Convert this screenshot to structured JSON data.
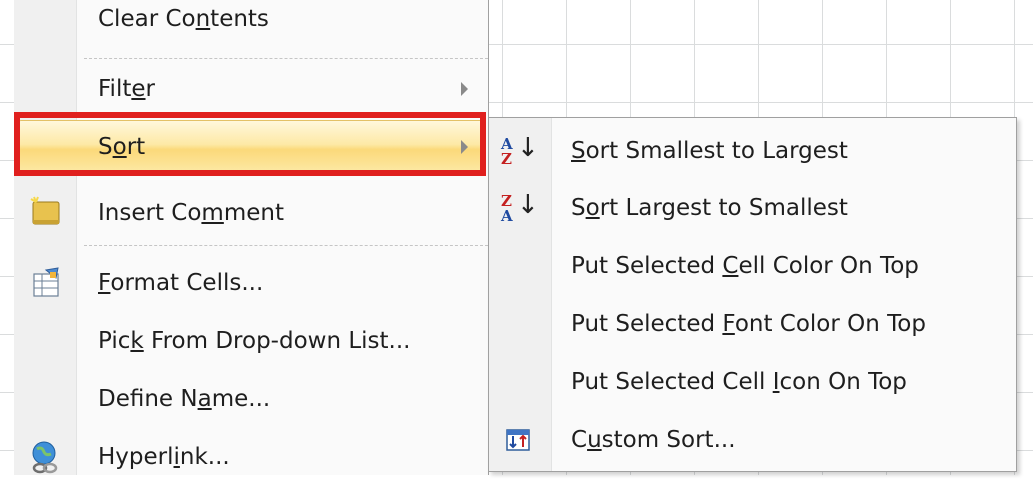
{
  "context_menu": {
    "items": [
      {
        "label_pre": "Clear Co",
        "label_u": "n",
        "label_post": "tents",
        "has_submenu": false
      },
      {
        "label_pre": "Filt",
        "label_u": "e",
        "label_post": "r",
        "has_submenu": true
      },
      {
        "label_pre": "S",
        "label_u": "o",
        "label_post": "rt",
        "has_submenu": true
      },
      {
        "label_pre": "Insert Co",
        "label_u": "m",
        "label_post": "ment",
        "has_submenu": false
      },
      {
        "label_pre": "",
        "label_u": "F",
        "label_post": "ormat Cells...",
        "has_submenu": false
      },
      {
        "label_pre": "Pic",
        "label_u": "k",
        "label_post": " From Drop-down List...",
        "has_submenu": false
      },
      {
        "label_pre": "Define N",
        "label_u": "a",
        "label_post": "me...",
        "has_submenu": false
      },
      {
        "label_pre": "Hyperl",
        "label_u": "i",
        "label_post": "nk...",
        "has_submenu": false
      }
    ],
    "highlighted_item": "Sort",
    "icons": [
      "insert-comment-icon",
      "format-cells-icon",
      "hyperlink-icon"
    ]
  },
  "sort_submenu": {
    "items": [
      {
        "label_pre": "",
        "label_u": "S",
        "label_post": "ort Smallest to Largest",
        "icon": "sort-ascending-icon"
      },
      {
        "label_pre": "S",
        "label_u": "o",
        "label_post": "rt Largest to Smallest",
        "icon": "sort-descending-icon"
      },
      {
        "label_pre": "Put Selected ",
        "label_u": "C",
        "label_post": "ell Color On Top",
        "icon": ""
      },
      {
        "label_pre": "Put Selected ",
        "label_u": "F",
        "label_post": "ont Color On Top",
        "icon": ""
      },
      {
        "label_pre": "Put Selected Cell ",
        "label_u": "I",
        "label_post": "con On Top",
        "icon": ""
      },
      {
        "label_pre": "C",
        "label_u": "u",
        "label_post": "stom Sort...",
        "icon": "custom-sort-icon"
      }
    ]
  },
  "sort_icon_letters": {
    "a": "A",
    "z": "Z",
    "arrow": "↓"
  },
  "colors": {
    "highlight_box": "#e0201e",
    "hover_fill": "#fde9a6"
  }
}
